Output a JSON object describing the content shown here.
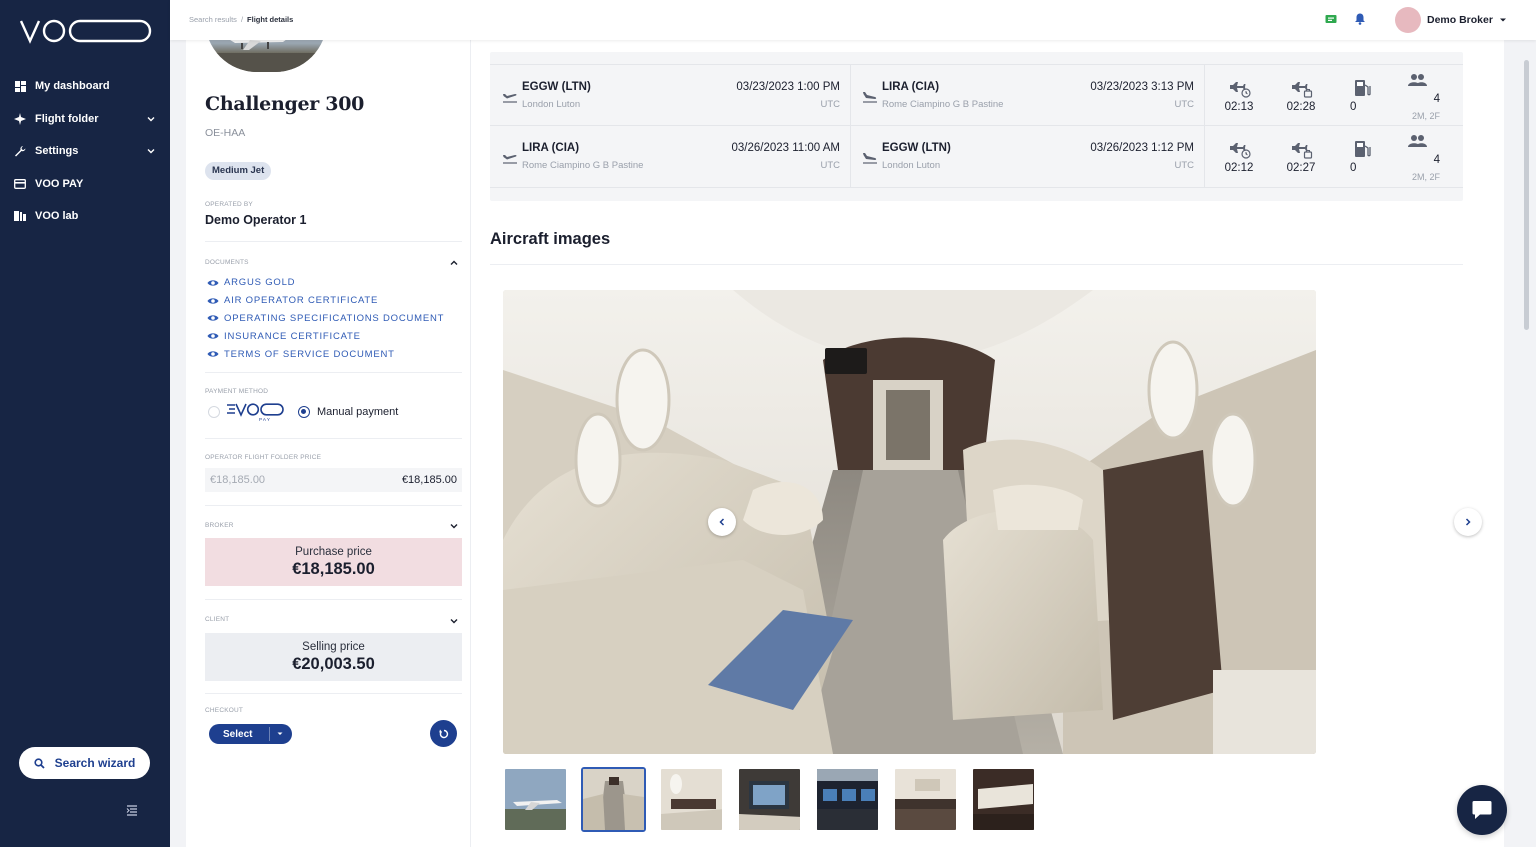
{
  "app": {
    "logo_text": "VOO"
  },
  "sidebar": {
    "items": [
      {
        "label": "My dashboard",
        "icon": "dashboard-icon"
      },
      {
        "label": "Flight folder",
        "icon": "flight-icon",
        "expandable": true
      },
      {
        "label": "Settings",
        "icon": "wrench-icon",
        "expandable": true
      },
      {
        "label": "VOO PAY",
        "icon": "card-icon"
      },
      {
        "label": "VOO lab",
        "icon": "book-icon"
      }
    ],
    "search_wizard": "Search wizard"
  },
  "topbar": {
    "breadcrumb": [
      "Search results",
      "Flight details"
    ],
    "user_name": "Demo Broker"
  },
  "aircraft": {
    "name": "Challenger 300",
    "registration": "OE-HAA",
    "category": "Medium Jet",
    "operated_by_label": "OPERATED BY",
    "operator": "Demo Operator 1"
  },
  "documents": {
    "label": "DOCUMENTS",
    "items": [
      "ARGUS GOLD",
      "AIR OPERATOR CERTIFICATE",
      "OPERATING SPECIFICATIONS DOCUMENT",
      "INSURANCE CERTIFICATE",
      "TERMS OF SERVICE DOCUMENT"
    ]
  },
  "payment": {
    "label": "PAYMENT METHOD",
    "voo_pay_logo": "VOO PAY",
    "manual_label": "Manual payment",
    "selected": "manual"
  },
  "operator_price": {
    "label": "OPERATOR FLIGHT FOLDER PRICE",
    "placeholder": "€18,185.00",
    "value": "€18,185.00"
  },
  "broker": {
    "label": "BROKER",
    "title": "Purchase price",
    "value": "€18,185.00"
  },
  "client": {
    "label": "CLIENT",
    "title": "Selling price",
    "value": "€20,003.50"
  },
  "checkout": {
    "label": "CHECKOUT",
    "select_label": "Select"
  },
  "flights": [
    {
      "dep_code": "EGGW (LTN)",
      "dep_city": "London Luton",
      "dep_time": "03/23/2023 1:00 PM",
      "dep_tz": "UTC",
      "arr_code": "LIRA (CIA)",
      "arr_city": "Rome Ciampino G B Pastine",
      "arr_time": "03/23/2023 3:13 PM",
      "arr_tz": "UTC",
      "flight_time": "02:13",
      "block_time": "02:28",
      "fuel_stops": "0",
      "pax": "4",
      "pax_detail": "2M, 2F"
    },
    {
      "dep_code": "LIRA (CIA)",
      "dep_city": "Rome Ciampino G B Pastine",
      "dep_time": "03/26/2023 11:00 AM",
      "dep_tz": "UTC",
      "arr_code": "EGGW (LTN)",
      "arr_city": "London Luton",
      "arr_time": "03/26/2023 1:12 PM",
      "arr_tz": "UTC",
      "flight_time": "02:12",
      "block_time": "02:27",
      "fuel_stops": "0",
      "pax": "4",
      "pax_detail": "2M, 2F"
    }
  ],
  "images_section": {
    "title": "Aircraft images",
    "thumbnail_count": 7,
    "active_index": 1
  },
  "colors": {
    "sidebar_bg": "#172544",
    "accent": "#1e3f8f",
    "link": "#2f5bb5",
    "purchase_bg": "#f2dde1"
  }
}
